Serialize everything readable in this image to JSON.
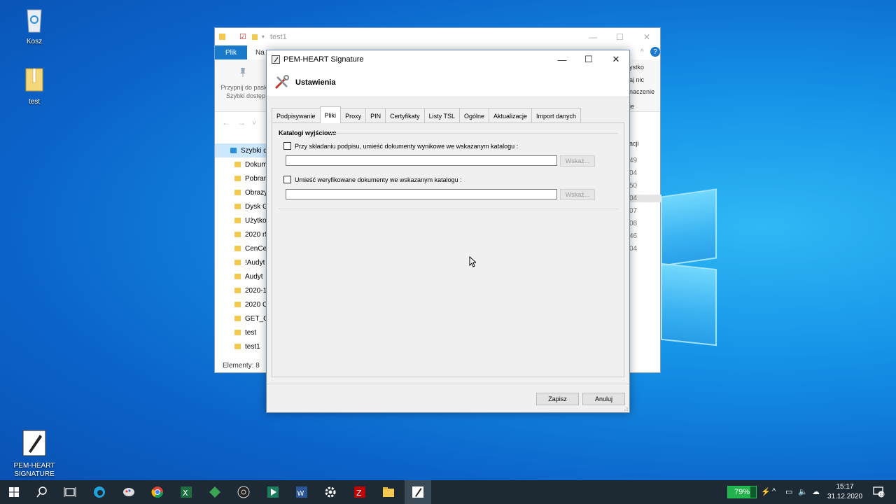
{
  "desktop": {
    "icons": [
      {
        "label": "Kosz"
      },
      {
        "label": "test"
      },
      {
        "label": "PEM-HEART\nSIGNATURE"
      }
    ]
  },
  "explorer": {
    "title": "test1",
    "file_tab": "Plik",
    "second_tab": "Na",
    "pin_label": "Przypnij do paska\nSzybki dostęp",
    "sidebar": [
      "Szybki d",
      "Dokum",
      "Pobran",
      "Obrazy",
      "Dysk G",
      "Użytko",
      "2020 r5",
      "CenCer",
      "!Audyt",
      "Audyt",
      "2020-1",
      "2020 C",
      "GET_CE",
      "test",
      "test1"
    ],
    "right_labels": [
      "ystko",
      "aj nic",
      "naczenie",
      "ie",
      "acji"
    ],
    "right_numbers": [
      "49",
      "04",
      "50",
      "04",
      "07",
      "08",
      "46",
      "04"
    ],
    "status": "Elementy: 8"
  },
  "dialog": {
    "title": "PEM-HEART Signature",
    "header_title": "Ustawienia",
    "tabs": [
      "Podpisywanie",
      "Pliki",
      "Proxy",
      "PIN",
      "Certyfikaty",
      "Listy TSL",
      "Ogólne",
      "Aktualizacje",
      "Import danych"
    ],
    "active_tab": "Pliki",
    "group_title": "Katalogi wyjściowe",
    "option1": {
      "label": "Przy składaniu podpisu, umieść dokumenty wynikowe we wskazanym katalogu :",
      "checked": false,
      "path": "",
      "browse": "Wskaż..."
    },
    "option2": {
      "label": "Umieść weryfikowane dokumenty we wskazanym katalogu :",
      "checked": false,
      "path": "",
      "browse": "Wskaż..."
    },
    "save": "Zapisz",
    "cancel": "Anuluj"
  },
  "taskbar": {
    "battery_percent": 79,
    "battery_label": "79%",
    "time": "15:17",
    "date": "31.12.2020",
    "notification_count": "12"
  },
  "colors": {
    "accent": "#1979ca",
    "taskbar": "#1e2a33",
    "battery": "#22b24c"
  }
}
